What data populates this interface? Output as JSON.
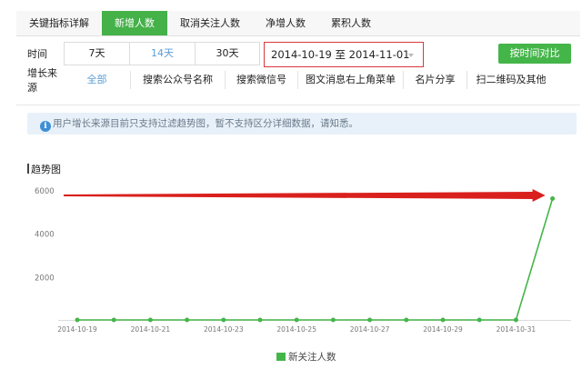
{
  "tabs": [
    {
      "label": "关键指标详解",
      "active": false
    },
    {
      "label": "新增人数",
      "active": true
    },
    {
      "label": "取消关注人数",
      "active": false
    },
    {
      "label": "净增人数",
      "active": false
    },
    {
      "label": "累积人数",
      "active": false
    }
  ],
  "time_filter": {
    "label": "时间",
    "options": [
      {
        "label": "7天",
        "selected": false
      },
      {
        "label": "14天",
        "selected": true
      },
      {
        "label": "30天",
        "selected": false
      }
    ],
    "date_range": "2014-10-19 至 2014-11-01",
    "compare_button": "按时间对比"
  },
  "source_filter": {
    "label": "增长来源",
    "options": [
      {
        "label": "全部",
        "selected": true
      },
      {
        "label": "搜索公众号名称",
        "selected": false
      },
      {
        "label": "搜索微信号",
        "selected": false
      },
      {
        "label": "图文消息右上角菜单",
        "selected": false
      },
      {
        "label": "名片分享",
        "selected": false
      },
      {
        "label": "扫二维码及其他",
        "selected": false
      }
    ]
  },
  "notice": {
    "icon": "info-icon",
    "text": "用户增长来源目前只支持过滤趋势图，暂不支持区分详细数据，请知悉。"
  },
  "chart_title": "趋势图",
  "chart_data": {
    "type": "line",
    "x": [
      "2014-10-19",
      "2014-10-20",
      "2014-10-21",
      "2014-10-22",
      "2014-10-23",
      "2014-10-24",
      "2014-10-25",
      "2014-10-26",
      "2014-10-27",
      "2014-10-28",
      "2014-10-29",
      "2014-10-30",
      "2014-10-31",
      "2014-11-01"
    ],
    "x_tick_labels": [
      "2014-10-19",
      "2014-10-21",
      "2014-10-23",
      "2014-10-25",
      "2014-10-27",
      "2014-10-29",
      "2014-10-31"
    ],
    "series": [
      {
        "name": "新关注人数",
        "values": [
          0,
          0,
          0,
          0,
          0,
          0,
          0,
          0,
          0,
          0,
          0,
          0,
          0,
          5600
        ],
        "color": "#44b549"
      }
    ],
    "ylim": [
      0,
      6000
    ],
    "y_ticks": [
      2000,
      4000,
      6000
    ],
    "grid": false,
    "legend": "bottom",
    "annotation": {
      "type": "arrow",
      "color": "#d9201d"
    }
  }
}
